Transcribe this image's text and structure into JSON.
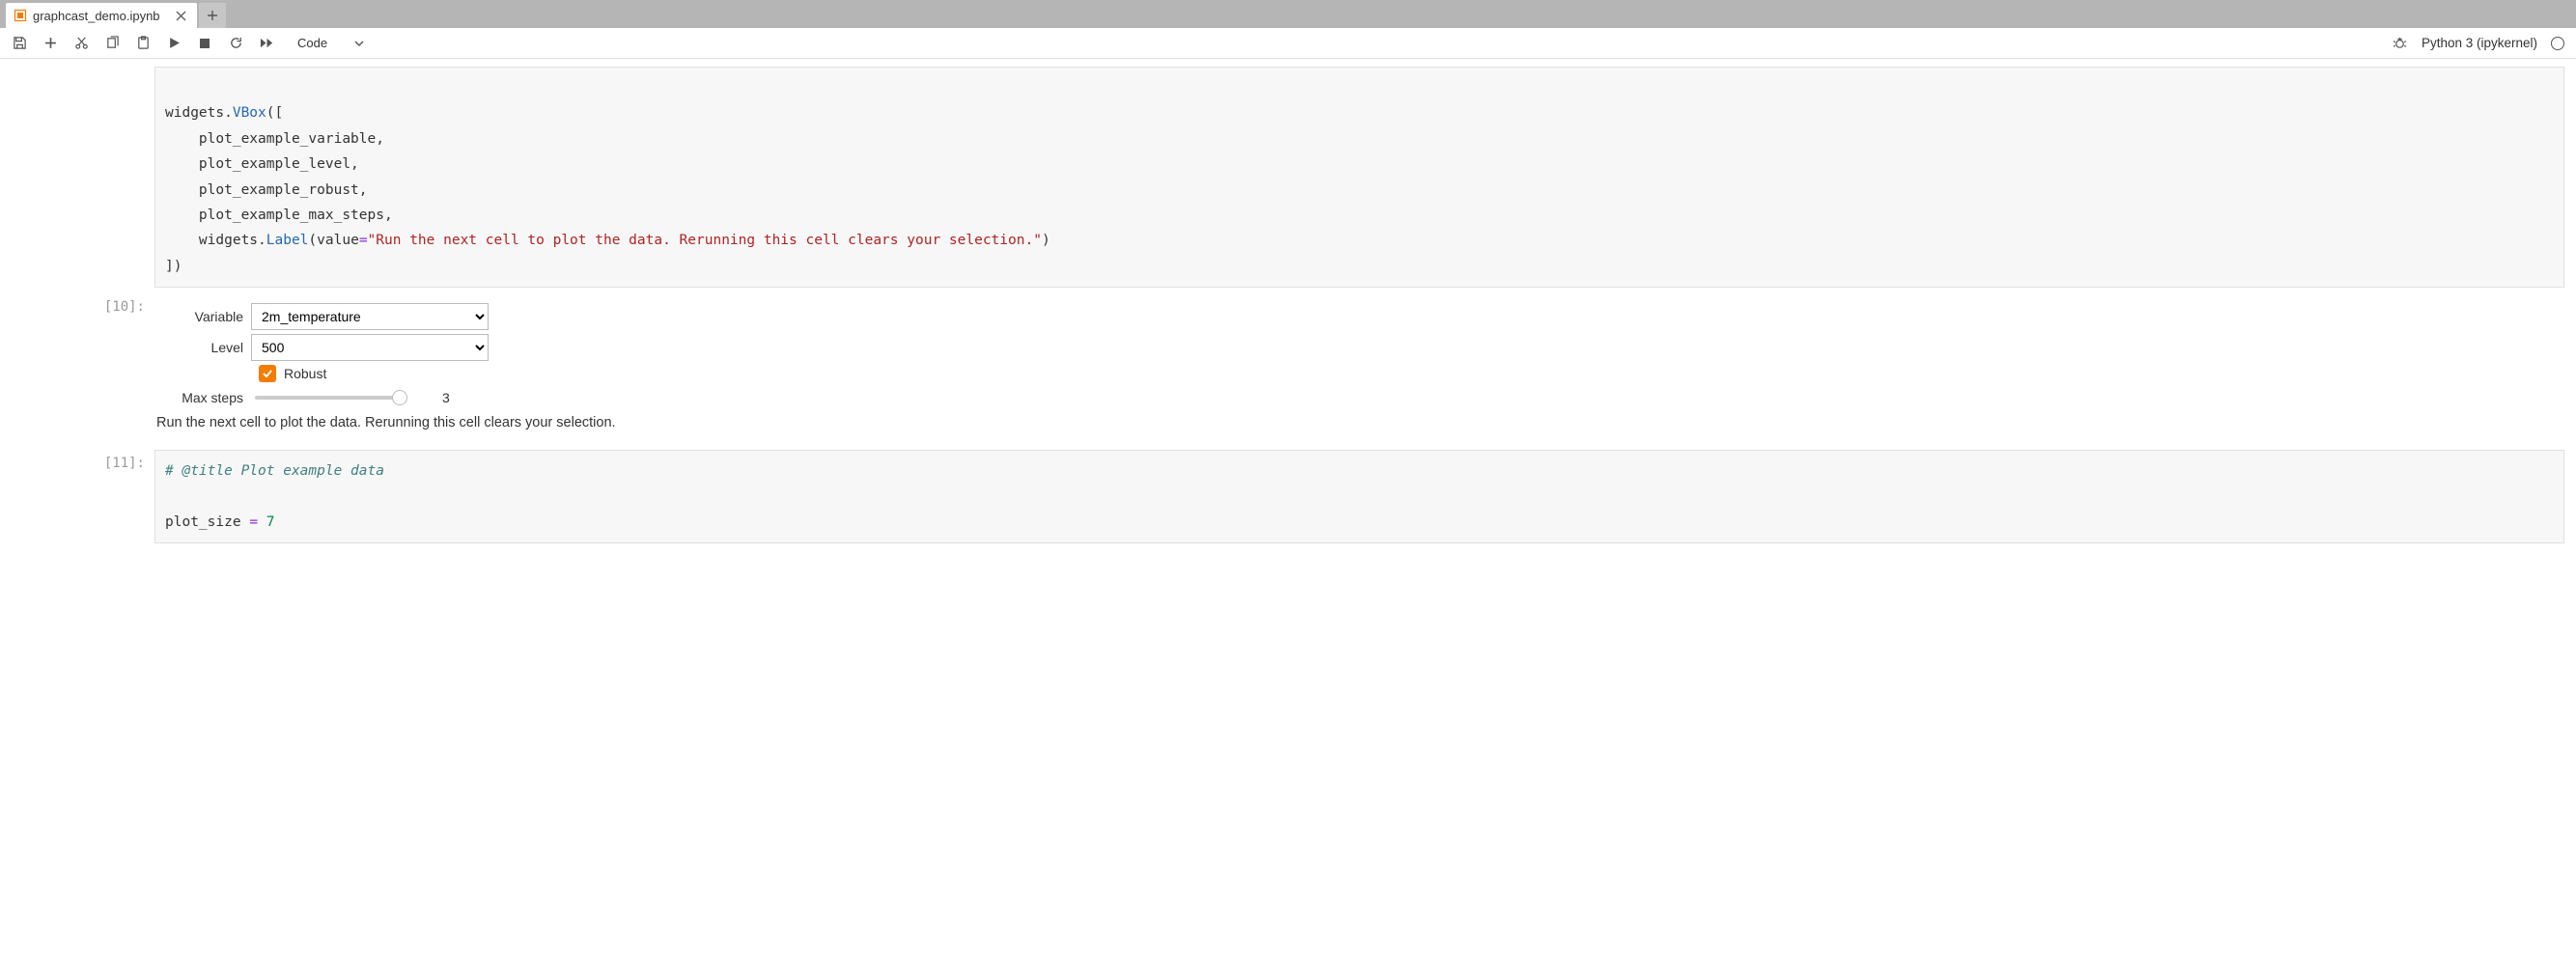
{
  "tab": {
    "title": "graphcast_demo.ipynb"
  },
  "toolbar": {
    "celltype": "Code",
    "kernel": "Python 3 (ipykernel)"
  },
  "cells": {
    "code1": {
      "lines": [
        {
          "t": "plain",
          "text": "widgets."
        },
        {
          "t": "attr",
          "text": "VBox"
        },
        {
          "t": "plain",
          "text": "(["
        }
      ],
      "body_indent": [
        "plot_example_variable,",
        "plot_example_level,",
        "plot_example_robust,",
        "plot_example_max_steps,"
      ],
      "label_line": {
        "pre": "widgets.",
        "attr": "Label",
        "mid1": "(value",
        "op": "=",
        "str": "\"Run the next cell to plot the data. Rerunning this cell clears your selection.\"",
        "post": ")"
      },
      "close": "])"
    },
    "out1_prompt": "[10]:",
    "widgets": {
      "variable_label": "Variable",
      "variable_value": "2m_temperature",
      "level_label": "Level",
      "level_value": "500",
      "robust_label": "Robust",
      "robust_checked": true,
      "maxsteps_label": "Max steps",
      "maxsteps_value": "3",
      "info": "Run the next cell to plot the data. Rerunning this cell clears your selection."
    },
    "code2_prompt": "[11]:",
    "code2": {
      "comment": "# @title Plot example data",
      "line2_pre": "plot_size ",
      "line2_op": "=",
      "line2_num": " 7"
    }
  }
}
